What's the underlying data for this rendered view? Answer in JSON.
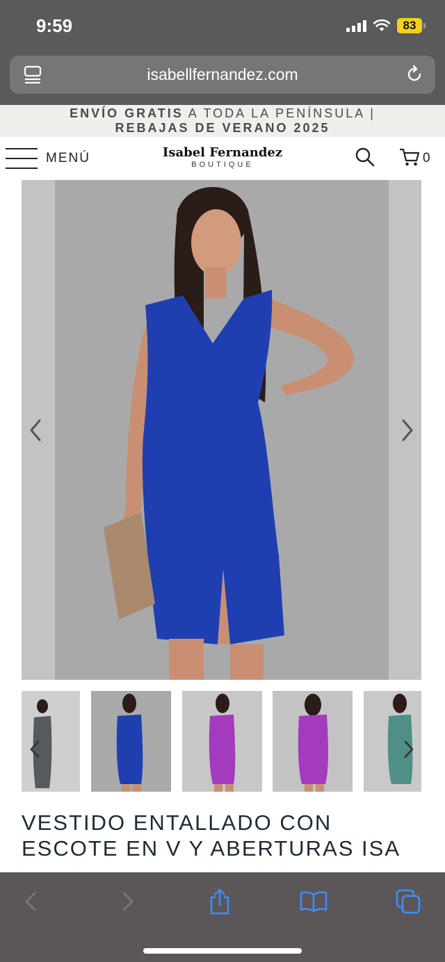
{
  "status_bar": {
    "time": "9:59",
    "battery": "83",
    "battery_color": "#f2d21b"
  },
  "browser": {
    "url": "isabellfernandez.com",
    "reader_icon": "reader-mode-icon",
    "reload_icon": "reload-icon"
  },
  "promo": {
    "line1_bold": "ENVÍO GRATIS",
    "line1_rest": " A TODA LA PENÍNSULA |",
    "line2": "REBAJAS DE VERANO 2025"
  },
  "header": {
    "menu_label": "MENÚ",
    "logo_main": "Isabel Fernandez",
    "logo_sub": "BOUTIQUE",
    "cart_count": "0"
  },
  "gallery": {
    "main_dress_color": "#1f3fb0",
    "thumbnails": [
      {
        "dress_color": "#555a5e"
      },
      {
        "dress_color": "#1f3fb0"
      },
      {
        "dress_color": "#a43bbf"
      },
      {
        "dress_color": "#a43bbf"
      },
      {
        "dress_color": "#4e8f86"
      }
    ]
  },
  "product": {
    "title": "VESTIDO ENTALLADO CON ESCOTE EN V Y ABERTURAS ISA"
  },
  "toolbar": {
    "accent": "#3d8ef7",
    "items": [
      "back-icon",
      "forward-icon",
      "share-icon",
      "bookmarks-icon",
      "tabs-icon"
    ]
  }
}
